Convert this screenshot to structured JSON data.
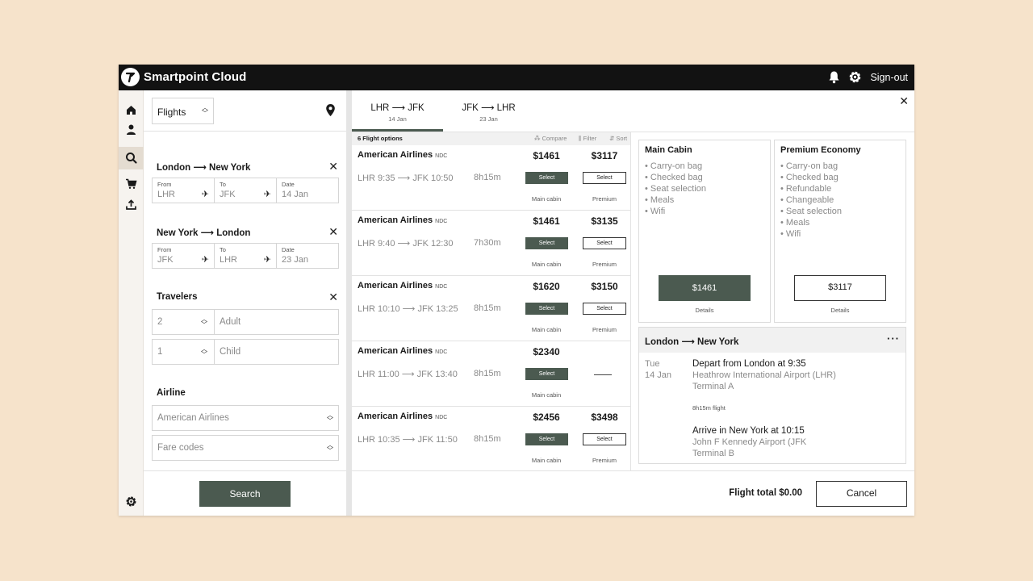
{
  "app": {
    "title": "Smartpoint Cloud",
    "signout_label": "Sign-out"
  },
  "colors": {
    "accent": "#4b5a50",
    "topbar": "#121212",
    "background": "#f6e3cb"
  },
  "rail": [
    "home-icon",
    "user-icon",
    "search-icon",
    "cart-icon",
    "upload-icon",
    "gear-icon"
  ],
  "search": {
    "product": "Flights",
    "legs": [
      {
        "title_from": "London",
        "title_to": "New York",
        "from_label": "From",
        "from": "LHR",
        "to_label": "To",
        "to": "JFK",
        "date_label": "Date",
        "date": "14 Jan"
      },
      {
        "title_from": "New York",
        "title_to": "London",
        "from_label": "From",
        "from": "JFK",
        "to_label": "To",
        "to": "LHR",
        "date_label": "Date",
        "date": "23 Jan"
      }
    ],
    "travelers_title": "Travelers",
    "travelers": [
      {
        "count": "2",
        "type": "Adult"
      },
      {
        "count": "1",
        "type": "Child"
      }
    ],
    "airline_title": "Airline",
    "airline_placeholder": "American Airlines",
    "fare_codes_placeholder": "Fare codes",
    "search_label": "Search"
  },
  "tabs": [
    {
      "from": "LHR",
      "to": "JFK",
      "date": "14 Jan"
    },
    {
      "from": "JFK",
      "to": "LHR",
      "date": "23 Jan"
    }
  ],
  "results": {
    "count_label": "6 Flight options",
    "compare": "Compare",
    "filter": "Filter",
    "sort": "Sort",
    "select_label": "Select",
    "rows": [
      {
        "airline": "American Airlines",
        "tag": "NDC",
        "dep": "LHR 9:35",
        "arr": "JFK 10:50",
        "duration": "8h15m",
        "main_price": "$1461",
        "main_cabin": "Main cabin",
        "prem_price": "$3117",
        "prem_cabin": "Premium"
      },
      {
        "airline": "American Airlines",
        "tag": "NDC",
        "dep": "LHR 9:40",
        "arr": "JFK 12:30",
        "duration": "7h30m",
        "main_price": "$1461",
        "main_cabin": "Main cabin",
        "prem_price": "$3135",
        "prem_cabin": "Premium"
      },
      {
        "airline": "American Airlines",
        "tag": "NDC",
        "dep": "LHR 10:10",
        "arr": "JFK 13:25",
        "duration": "8h15m",
        "main_price": "$1620",
        "main_cabin": "Main cabin",
        "prem_price": "$3150",
        "prem_cabin": "Premium"
      },
      {
        "airline": "American Airlines",
        "tag": "NDC",
        "dep": "LHR 11:00",
        "arr": "JFK 13:40",
        "duration": "8h15m",
        "main_price": "$2340",
        "main_cabin": "Main cabin",
        "prem_price": "",
        "prem_cabin": ""
      },
      {
        "airline": "American Airlines",
        "tag": "NDC",
        "dep": "LHR 10:35",
        "arr": "JFK 11:50",
        "duration": "8h15m",
        "main_price": "$2456",
        "main_cabin": "Main cabin",
        "prem_price": "$3498",
        "prem_cabin": "Premium"
      }
    ]
  },
  "fares": [
    {
      "name": "Main Cabin",
      "features": [
        "Carry-on bag",
        "Checked bag",
        "Seat selection",
        "Meals",
        "Wifi"
      ],
      "price": "$1461",
      "details": "Details"
    },
    {
      "name": "Premium Economy",
      "features": [
        "Carry-on bag",
        "Checked bag",
        "Refundable",
        "Changeable",
        "Seat selection",
        "Meals",
        "Wifi"
      ],
      "price": "$3117",
      "details": "Details"
    }
  ],
  "itinerary": {
    "from": "London",
    "to": "New York",
    "day": "Tue",
    "date": "14 Jan",
    "depart_title": "Depart from London at 9:35",
    "depart_airport": "Heathrow International Airport (LHR)",
    "depart_terminal": "Terminal A",
    "flight_time": "8h15m flight",
    "arrive_title": "Arrive in New York at 10:15",
    "arrive_airport": "John F Kennedy Airport (JFK",
    "arrive_terminal": "Terminal B"
  },
  "footer": {
    "total": "Flight total $0.00",
    "cancel_label": "Cancel"
  }
}
